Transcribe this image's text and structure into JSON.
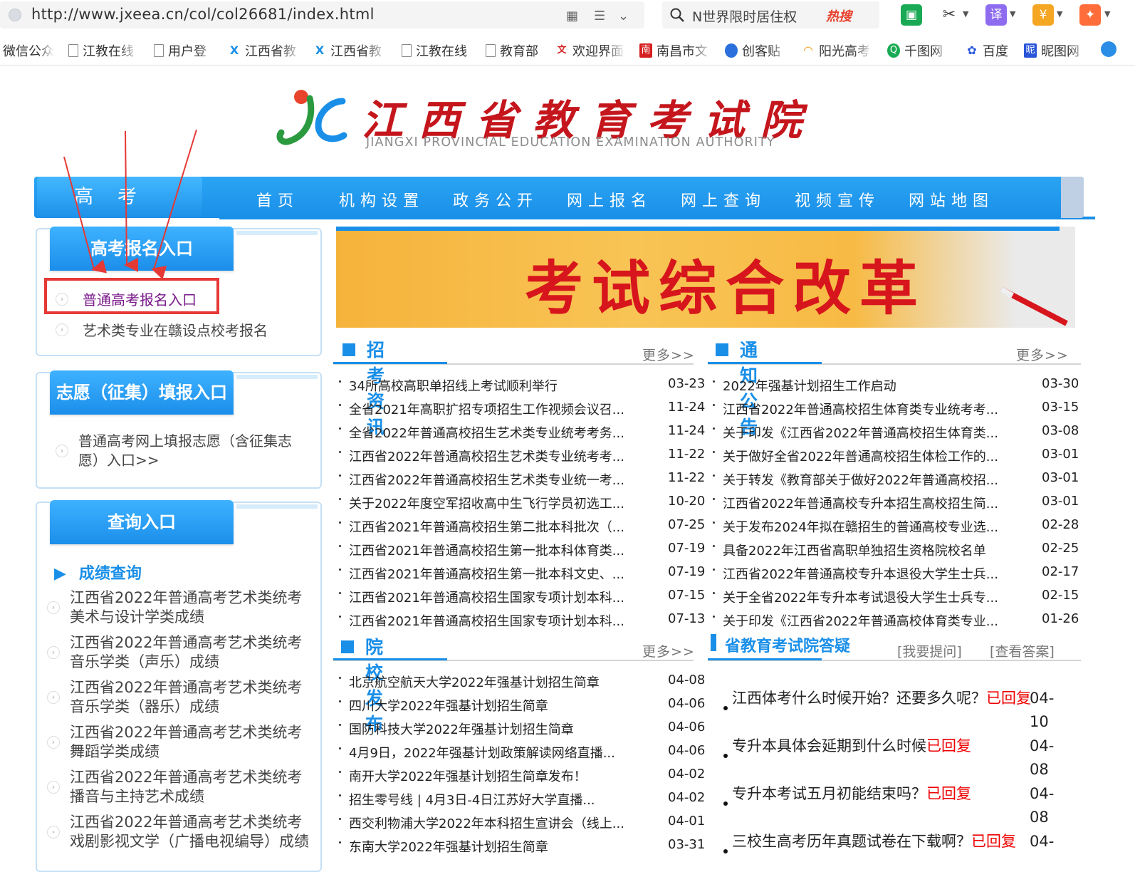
{
  "browser": {
    "url": "http://www.jxeea.cn/col/col26681/index.html",
    "search_text": "N世界限时居住权",
    "hot_label": "热搜"
  },
  "bookmarks": [
    {
      "label": "微信公众",
      "icon": "none"
    },
    {
      "label": "江教在线",
      "icon": "doc"
    },
    {
      "label": "用户登",
      "icon": "doc"
    },
    {
      "label": "江西省教",
      "icon": "jx-logo"
    },
    {
      "label": "江西省教",
      "icon": "jx-logo"
    },
    {
      "label": "江教在线",
      "icon": "doc"
    },
    {
      "label": "教育部",
      "icon": "doc"
    },
    {
      "label": "欢迎界面",
      "icon": "red-icon"
    },
    {
      "label": "南昌市文",
      "icon": "red-square-icon"
    },
    {
      "label": "创客贴",
      "icon": "blue-drop-icon"
    },
    {
      "label": "阳光高考",
      "icon": "rainbow-icon"
    },
    {
      "label": "千图网",
      "icon": "green-circle-icon"
    },
    {
      "label": "百度",
      "icon": "baidu-paw-icon"
    },
    {
      "label": "昵图网",
      "icon": "nipic-icon"
    }
  ],
  "site": {
    "title": "江西省教育考试院",
    "subtitle": "JIANGXI PROVINCIAL EDUCATION EXAMINATION AUTHORITY",
    "tab": "高考"
  },
  "nav": [
    "首页",
    "机构设置",
    "政务公开",
    "网上报名",
    "网上查询",
    "视频宣传",
    "网站地图"
  ],
  "sidebar": {
    "reg": {
      "title": "高考报名入口",
      "links": [
        "普通高考报名入口",
        "艺术类专业在赣设点校考报名"
      ]
    },
    "vol": {
      "title": "志愿（征集）填报入口",
      "link": "普通高考网上填报志愿（含征集志愿）入口>>"
    },
    "query": {
      "title": "查询入口",
      "sub": "成绩查询",
      "links": [
        "江西省2022年普通高考艺术类统考美术与设计学类成绩",
        "江西省2022年普通高考艺术类统考音乐学类（声乐）成绩",
        "江西省2022年普通高考艺术类统考音乐学类（器乐）成绩",
        "江西省2022年普通高考艺术类统考舞蹈学类成绩",
        "江西省2022年普通高考艺术类统考播音与主持艺术成绩",
        "江西省2022年普通高考艺术类统考戏剧影视文学（广播电视编导）成绩"
      ]
    }
  },
  "banner": {
    "text": "考试综合改革"
  },
  "sections": {
    "zk": {
      "title": "招考资讯",
      "more": "更多>>",
      "items": [
        {
          "t": "34所高校高职单招线上考试顺利举行",
          "d": "03-23"
        },
        {
          "t": "全省2021年高职扩招专项招生工作视频会议召...",
          "d": "11-24"
        },
        {
          "t": "全省2022年普通高校招生艺术类专业统考考务...",
          "d": "11-24"
        },
        {
          "t": "江西省2022年普通高校招生艺术类专业统考考...",
          "d": "11-22"
        },
        {
          "t": "江西省2022年普通高校招生艺术类专业统一考...",
          "d": "11-22"
        },
        {
          "t": "关于2022年度空军招收高中生飞行学员初选工...",
          "d": "10-20"
        },
        {
          "t": "江西省2021年普通高校招生第二批本科批次（...",
          "d": "07-25"
        },
        {
          "t": "江西省2021年普通高校招生第一批本科体育类...",
          "d": "07-19"
        },
        {
          "t": "江西省2021年普通高校招生第一批本科文史、...",
          "d": "07-19"
        },
        {
          "t": "江西省2021年普通高校招生国家专项计划本科...",
          "d": "07-15"
        },
        {
          "t": "江西省2021年普通高校招生国家专项计划本科...",
          "d": "07-13"
        }
      ]
    },
    "tz": {
      "title": "通知公告",
      "more": "更多>>",
      "items": [
        {
          "t": "2022年强基计划招生工作启动",
          "d": "03-30"
        },
        {
          "t": "江西省2022年普通高校招生体育类专业统考考...",
          "d": "03-15"
        },
        {
          "t": "关于印发《江西省2022年普通高校招生体育类...",
          "d": "03-08"
        },
        {
          "t": "关于做好全省2022年普通高校招生体检工作的...",
          "d": "03-01"
        },
        {
          "t": "关于转发《教育部关于做好2022年普通高校招...",
          "d": "03-01"
        },
        {
          "t": "江西省2022年普通高校专升本招生高校招生简...",
          "d": "03-01"
        },
        {
          "t": "关于发布2024年拟在赣招生的普通高校专业选...",
          "d": "02-28"
        },
        {
          "t": "具备2022年江西省高职单独招生资格院校名单",
          "d": "02-25"
        },
        {
          "t": "江西省2022年普通高校专升本退役大学生士兵...",
          "d": "02-17"
        },
        {
          "t": "关于全省2022年专升本考试退役大学生士兵专...",
          "d": "02-15"
        },
        {
          "t": "关于印发《江西省2022年普通高校体育类专业...",
          "d": "01-26"
        }
      ]
    },
    "yx": {
      "title": "院校发布",
      "more": "更多>>",
      "items": [
        {
          "t": "北京航空航天大学2022年强基计划招生简章",
          "d": "04-08"
        },
        {
          "t": "四川大学2022年强基计划招生简章",
          "d": "04-06"
        },
        {
          "t": "国防科技大学2022年强基计划招生简章",
          "d": "04-06"
        },
        {
          "t": "4月9日，2022年强基计划政策解读网络直播...",
          "d": "04-06"
        },
        {
          "t": "南开大学2022年强基计划招生简章发布！",
          "d": "04-02"
        },
        {
          "t": "招生零号线 | 4月3日-4日江苏好大学直播...",
          "d": "04-02"
        },
        {
          "t": "西交利物浦大学2022年本科招生宣讲会（线上...",
          "d": "04-01"
        },
        {
          "t": "东南大学2022年强基计划招生简章",
          "d": "03-31"
        }
      ]
    },
    "qa": {
      "title": "省教育考试院答疑",
      "ask": "[我要提问]",
      "view": "[查看答案]",
      "items": [
        {
          "q": "江西体考什么时候开始？还要多久呢？",
          "r": "已回复",
          "d": "04-10"
        },
        {
          "q": "专升本具体会延期到什么时候",
          "r": "已回复",
          "d": "04-08"
        },
        {
          "q": "专升本考试五月初能结束吗？",
          "r": "已回复",
          "d": "04-08"
        },
        {
          "q": "三校生高考历年真题试卷在下载啊？",
          "r": "已回复",
          "d": "04-"
        }
      ]
    }
  },
  "colors": {
    "accent": "#1a8fe8",
    "brand_red": "#c4161c",
    "highlight": "#e53935"
  }
}
